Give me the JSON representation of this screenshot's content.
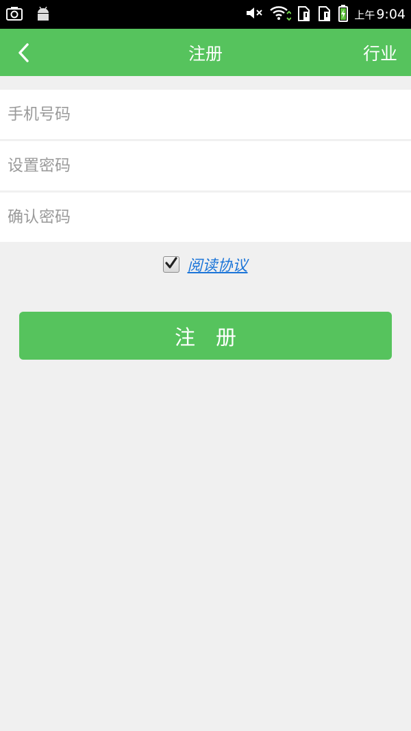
{
  "statusbar": {
    "ampm": "上午",
    "time": "9:04"
  },
  "appbar": {
    "title": "注册",
    "action_label": "行业"
  },
  "form": {
    "phone_placeholder": "手机号码",
    "password_placeholder": "设置密码",
    "confirm_placeholder": "确认密码"
  },
  "agreement": {
    "checked": true,
    "link_label": "阅读协议"
  },
  "register_button_label": "注　册",
  "colors": {
    "accent": "#56c35d",
    "link": "#1a74d8",
    "background": "#f0f0f0"
  }
}
